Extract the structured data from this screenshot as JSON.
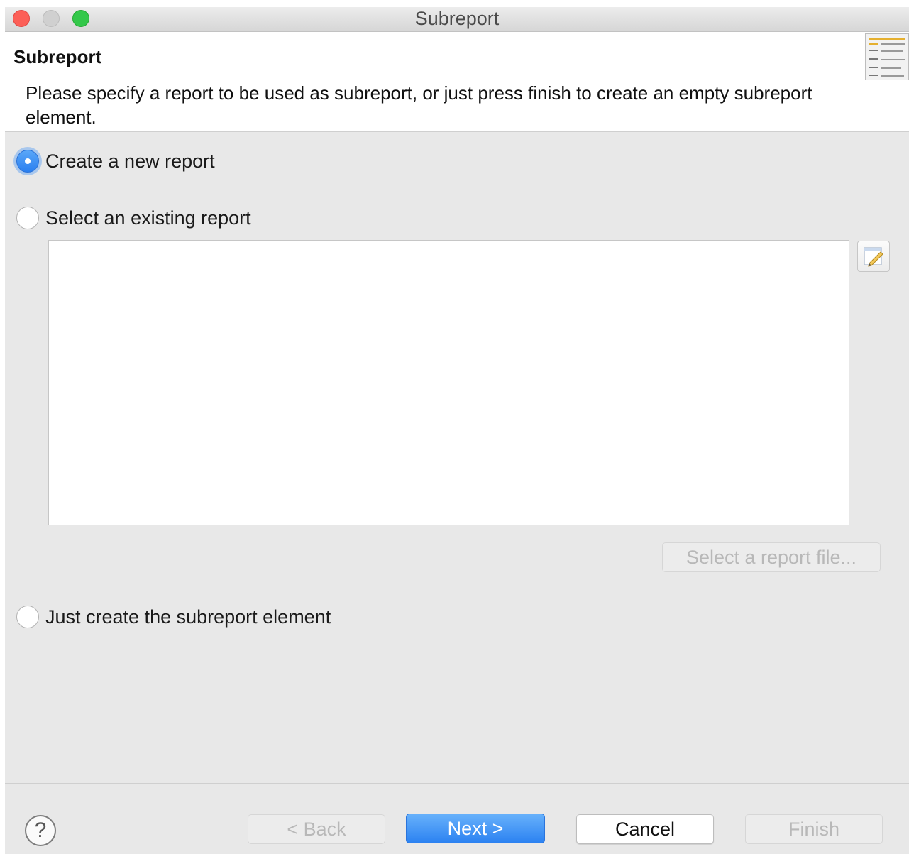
{
  "window": {
    "title": "Subreport"
  },
  "header": {
    "title": "Subreport",
    "description": "Please specify a report to be used as subreport, or just press finish to create an empty subreport element."
  },
  "options": {
    "create_new": {
      "label": "Create a new report",
      "selected": true
    },
    "select_existing": {
      "label": "Select an existing report",
      "selected": false
    },
    "just_element": {
      "label": "Just create the subreport element",
      "selected": false
    }
  },
  "select_file_button": {
    "label": "Select a report file...",
    "enabled": false
  },
  "footer": {
    "help_glyph": "?",
    "back": {
      "label": "< Back",
      "enabled": false
    },
    "next": {
      "label": "Next >",
      "enabled": true
    },
    "cancel": {
      "label": "Cancel",
      "enabled": true
    },
    "finish": {
      "label": "Finish",
      "enabled": false
    }
  },
  "colors": {
    "accent": "#2c82f1",
    "close": "#fc5f57",
    "zoom": "#34c84a"
  },
  "icons": {
    "wizard": "report-wizard-icon",
    "edit": "edit-icon",
    "help": "help-icon"
  }
}
